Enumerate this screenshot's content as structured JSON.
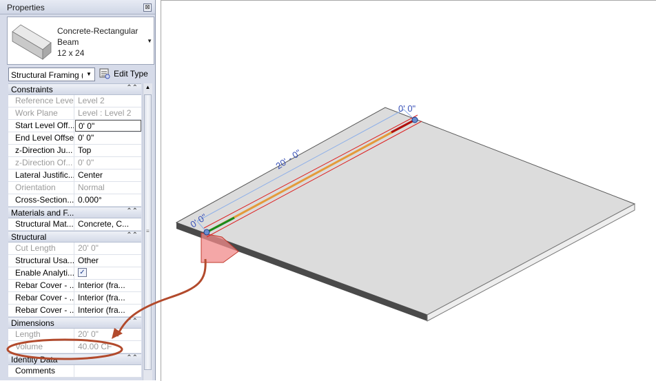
{
  "panel": {
    "title": "Properties",
    "close_glyph": "⊠",
    "type_selector": {
      "name_lines": [
        "Concrete-Rectangular",
        "Beam",
        "12 x 24"
      ]
    },
    "instance_filter": {
      "value": "Structural Framing (",
      "dropdown_icon": "triangle-down-icon"
    },
    "edit_type_label": "Edit Type"
  },
  "sections": [
    {
      "name": "Constraints",
      "rows": [
        {
          "label": "Reference Level",
          "value": "Level 2",
          "disabled": true
        },
        {
          "label": "Work Plane",
          "value": "Level : Level 2",
          "disabled": true
        },
        {
          "label": "Start Level Off...",
          "value": "0'  0\"",
          "disabled": false,
          "selected": true
        },
        {
          "label": "End Level Offset",
          "value": "0'  0\"",
          "disabled": false
        },
        {
          "label": "z-Direction Ju...",
          "value": "Top",
          "disabled": false
        },
        {
          "label": "z-Direction Of...",
          "value": "0'  0\"",
          "disabled": true
        },
        {
          "label": "Lateral Justific...",
          "value": "Center",
          "disabled": false
        },
        {
          "label": "Orientation",
          "value": "Normal",
          "disabled": true
        },
        {
          "label": "Cross-Section...",
          "value": "0.000°",
          "disabled": false
        }
      ]
    },
    {
      "name": "Materials and F...",
      "rows": [
        {
          "label": "Structural Mat...",
          "value": "Concrete, C...",
          "disabled": false
        }
      ]
    },
    {
      "name": "Structural",
      "rows": [
        {
          "label": "Cut Length",
          "value": "20'  0\"",
          "disabled": true
        },
        {
          "label": "Structural Usa...",
          "value": "Other",
          "disabled": false
        },
        {
          "label": "Enable Analyti...",
          "value": "✓",
          "disabled": false,
          "checkbox": true
        },
        {
          "label": "Rebar Cover - ...",
          "value": "Interior (fra...",
          "disabled": false
        },
        {
          "label": "Rebar Cover - ...",
          "value": "Interior (fra...",
          "disabled": false
        },
        {
          "label": "Rebar Cover - ...",
          "value": "Interior (fra...",
          "disabled": false
        }
      ]
    },
    {
      "name": "Dimensions",
      "rows": [
        {
          "label": "Length",
          "value": "20'  0\"",
          "disabled": true
        },
        {
          "label": "Volume",
          "value": "40.00 CF",
          "disabled": true
        }
      ]
    },
    {
      "name": "Identity Data",
      "rows": [
        {
          "label": "Comments",
          "value": "",
          "disabled": false
        }
      ]
    }
  ],
  "viewport": {
    "dim_total": "20' - 0\"",
    "dim_start": "0'  0\"",
    "dim_end": "0'  0\""
  },
  "colors": {
    "highlight_red": "#c0392b",
    "dimension_blue": "#3a52b8",
    "slab_top": "#dcdcdc",
    "slab_side": "#4a4a4a"
  }
}
